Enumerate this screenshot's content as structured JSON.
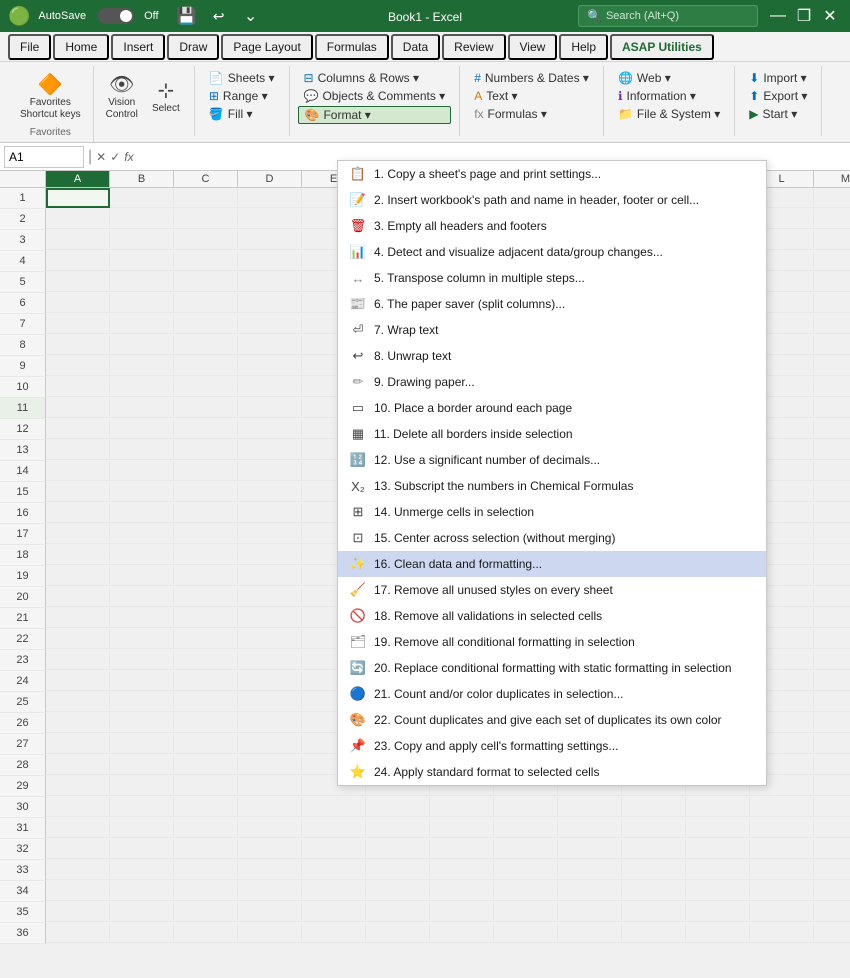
{
  "titlebar": {
    "excel_icon": "X",
    "autosave_label": "AutoSave",
    "autosave_state": "Off",
    "save_icon": "💾",
    "undo_icon": "↩",
    "filename": "Book1  -  Excel",
    "search_placeholder": "Search (Alt+Q)",
    "minimize": "—",
    "restore": "❐",
    "close": "✕"
  },
  "menubar": {
    "items": [
      "File",
      "Home",
      "Insert",
      "Draw",
      "Page Layout",
      "Formulas",
      "Data",
      "Review",
      "View",
      "Help",
      "ASAP Utilities"
    ]
  },
  "ribbon": {
    "favorites_label": "Favorites",
    "favorites_btn": "Favorites\nShortcut keys",
    "vision_btn": "Vision\nControl",
    "select_btn": "Select",
    "sheets_btn": "Sheets ▾",
    "range_btn": "Range ▾",
    "fill_btn": "Fill ▾",
    "columns_rows_btn": "Columns & Rows ▾",
    "objects_comments_btn": "Objects & Comments ▾",
    "format_btn": "Format ▾",
    "numbers_dates_btn": "Numbers & Dates ▾",
    "text_btn": "Text ▾",
    "formulas_btn": "Formulas ▾",
    "web_btn": "Web ▾",
    "information_btn": "Information ▾",
    "file_system_btn": "File & System ▾",
    "import_btn": "Import ▾",
    "export_btn": "Export ▾",
    "start_btn": "Start ▾"
  },
  "formulabar": {
    "cell_name": "A1",
    "formula_content": ""
  },
  "spreadsheet": {
    "columns": [
      "A",
      "B",
      "C",
      "D",
      "E",
      "M"
    ],
    "rows": [
      1,
      2,
      3,
      4,
      5,
      6,
      7,
      8,
      9,
      10,
      11,
      12,
      13,
      14,
      15,
      16,
      17,
      18,
      19,
      20,
      21,
      22,
      23,
      24,
      25,
      26,
      27,
      28,
      29,
      30,
      31,
      32,
      33,
      34,
      35,
      36
    ]
  },
  "dropdown": {
    "items": [
      {
        "num": "1.",
        "text": "Copy a sheet's page and print settings...",
        "icon": "📋",
        "icon_type": "page"
      },
      {
        "num": "2.",
        "text": "Insert workbook's path and name in header, footer or cell...",
        "icon": "📝",
        "icon_type": "insert"
      },
      {
        "num": "3.",
        "text": "Empty all headers and footers",
        "icon": "🗑",
        "icon_type": "delete"
      },
      {
        "num": "4.",
        "text": "Detect and visualize adjacent data/group changes...",
        "icon": "📊",
        "icon_type": "detect"
      },
      {
        "num": "5.",
        "text": "Transpose column in multiple steps...",
        "icon": "↔",
        "icon_type": "transpose"
      },
      {
        "num": "6.",
        "text": "The paper saver (split columns)...",
        "icon": "📰",
        "icon_type": "paper"
      },
      {
        "num": "7.",
        "text": "Wrap text",
        "icon": "⤵",
        "icon_type": "wrap"
      },
      {
        "num": "8.",
        "text": "Unwrap text",
        "icon": "⤴",
        "icon_type": "unwrap"
      },
      {
        "num": "9.",
        "text": "Drawing paper...",
        "icon": "✏",
        "icon_type": "draw"
      },
      {
        "num": "10.",
        "text": "Place a border around each page",
        "icon": "▭",
        "icon_type": "border-page"
      },
      {
        "num": "11.",
        "text": "Delete all borders inside selection",
        "icon": "▦",
        "icon_type": "border-del"
      },
      {
        "num": "12.",
        "text": "Use a significant number of decimals...",
        "icon": "🔢",
        "icon_type": "decimals"
      },
      {
        "num": "13.",
        "text": "Subscript the numbers in Chemical Formulas",
        "icon": "X₂",
        "icon_type": "subscript"
      },
      {
        "num": "14.",
        "text": "Unmerge cells in selection",
        "icon": "⊞",
        "icon_type": "unmerge"
      },
      {
        "num": "15.",
        "text": "Center across selection (without merging)",
        "icon": "⊡",
        "icon_type": "center"
      },
      {
        "num": "16.",
        "text": "Clean data and formatting...",
        "icon": "✨",
        "icon_type": "clean",
        "highlighted": true
      },
      {
        "num": "17.",
        "text": "Remove all unused styles on every sheet",
        "icon": "🧹",
        "icon_type": "remove-styles"
      },
      {
        "num": "18.",
        "text": "Remove all validations in selected cells",
        "icon": "🚫",
        "icon_type": "remove-val"
      },
      {
        "num": "19.",
        "text": "Remove all conditional formatting in selection",
        "icon": "🗂",
        "icon_type": "remove-cond"
      },
      {
        "num": "20.",
        "text": "Replace conditional formatting with static formatting in selection",
        "icon": "🔄",
        "icon_type": "replace-cond"
      },
      {
        "num": "21.",
        "text": "Count and/or color duplicates in selection...",
        "icon": "🔵",
        "icon_type": "count-dup"
      },
      {
        "num": "22.",
        "text": "Count duplicates and give each set of duplicates its own color",
        "icon": "🎨",
        "icon_type": "color-dup"
      },
      {
        "num": "23.",
        "text": "Copy and apply cell's formatting settings...",
        "icon": "📌",
        "icon_type": "copy-fmt"
      },
      {
        "num": "24.",
        "text": "Apply standard format to selected cells",
        "icon": "⭐",
        "icon_type": "standard-fmt"
      }
    ]
  }
}
